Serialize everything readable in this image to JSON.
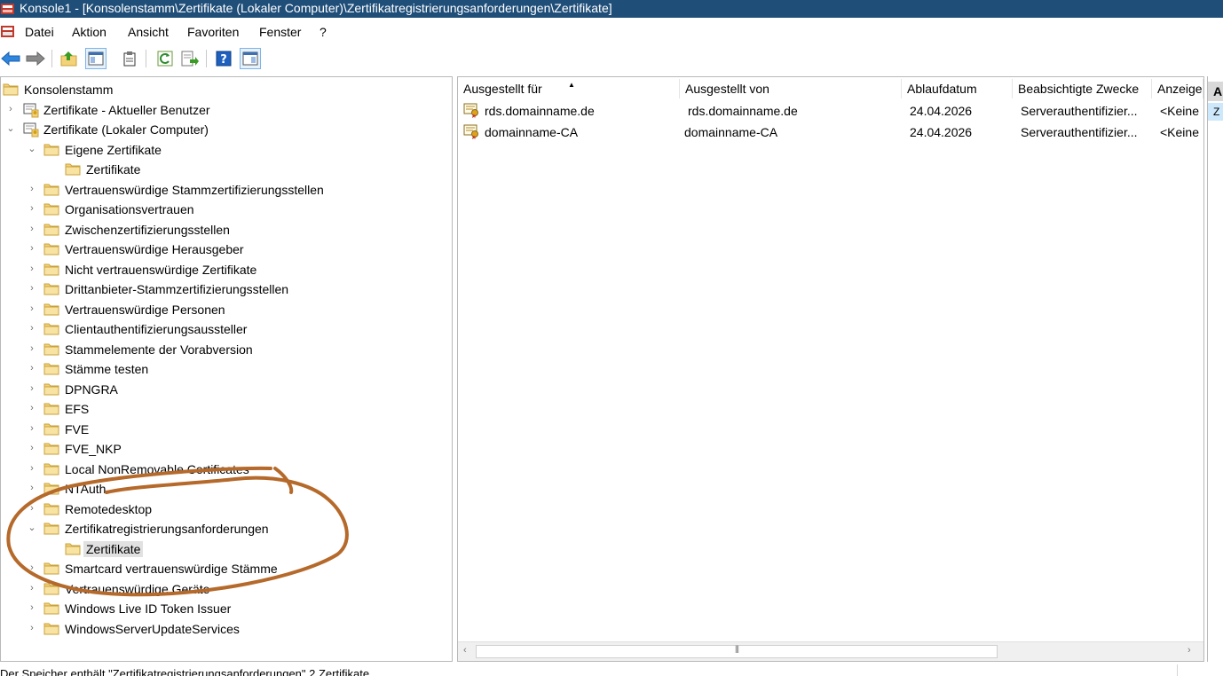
{
  "window": {
    "title": "Konsole1 - [Konsolenstamm\\Zertifikate (Lokaler Computer)\\Zertifikatregistrierungsanforderungen\\Zertifikate]"
  },
  "colors": {
    "titlebar": "#1f4e79",
    "annotation": "#b5692a",
    "folder": "#f3d27a",
    "selection": "#e1e1e1"
  },
  "menu": [
    "Datei",
    "Aktion",
    "Ansicht",
    "Favoriten",
    "Fenster",
    "?"
  ],
  "toolbar": {
    "buttons": [
      {
        "name": "back-arrow-icon"
      },
      {
        "name": "forward-arrow-icon"
      },
      {
        "name": "up-folder-icon"
      },
      {
        "name": "show-hide-tree-icon"
      },
      {
        "name": "clipboard-icon"
      },
      {
        "name": "refresh-icon"
      },
      {
        "name": "export-list-icon"
      },
      {
        "name": "help-icon"
      },
      {
        "name": "show-hide-action-pane-icon"
      }
    ]
  },
  "tree": {
    "items": [
      {
        "label": "Konsolenstamm",
        "indent": 0,
        "expander": "none",
        "icon": "folder-icon"
      },
      {
        "label": "Zertifikate - Aktueller Benutzer",
        "indent": 1,
        "expander": "collapsed",
        "icon": "certificate-snapin-icon"
      },
      {
        "label": "Zertifikate (Lokaler Computer)",
        "indent": 1,
        "expander": "expanded",
        "icon": "certificate-snapin-icon"
      },
      {
        "label": "Eigene Zertifikate",
        "indent": 2,
        "expander": "expanded",
        "icon": "folder-icon"
      },
      {
        "label": "Zertifikate",
        "indent": 3,
        "expander": "none",
        "icon": "folder-icon"
      },
      {
        "label": "Vertrauenswürdige Stammzertifizierungsstellen",
        "indent": 2,
        "expander": "collapsed",
        "icon": "folder-icon"
      },
      {
        "label": "Organisationsvertrauen",
        "indent": 2,
        "expander": "collapsed",
        "icon": "folder-icon"
      },
      {
        "label": "Zwischenzertifizierungsstellen",
        "indent": 2,
        "expander": "collapsed",
        "icon": "folder-icon"
      },
      {
        "label": "Vertrauenswürdige Herausgeber",
        "indent": 2,
        "expander": "collapsed",
        "icon": "folder-icon"
      },
      {
        "label": "Nicht vertrauenswürdige Zertifikate",
        "indent": 2,
        "expander": "collapsed",
        "icon": "folder-icon"
      },
      {
        "label": "Drittanbieter-Stammzertifizierungsstellen",
        "indent": 2,
        "expander": "collapsed",
        "icon": "folder-icon"
      },
      {
        "label": "Vertrauenswürdige Personen",
        "indent": 2,
        "expander": "collapsed",
        "icon": "folder-icon"
      },
      {
        "label": "Clientauthentifizierungsaussteller",
        "indent": 2,
        "expander": "collapsed",
        "icon": "folder-icon"
      },
      {
        "label": "Stammelemente der Vorabversion",
        "indent": 2,
        "expander": "collapsed",
        "icon": "folder-icon"
      },
      {
        "label": "Stämme testen",
        "indent": 2,
        "expander": "collapsed",
        "icon": "folder-icon"
      },
      {
        "label": "DPNGRA",
        "indent": 2,
        "expander": "collapsed",
        "icon": "folder-icon"
      },
      {
        "label": "EFS",
        "indent": 2,
        "expander": "collapsed",
        "icon": "folder-icon"
      },
      {
        "label": "FVE",
        "indent": 2,
        "expander": "collapsed",
        "icon": "folder-icon"
      },
      {
        "label": "FVE_NKP",
        "indent": 2,
        "expander": "collapsed",
        "icon": "folder-icon"
      },
      {
        "label": "Local NonRemovable Certificates",
        "indent": 2,
        "expander": "collapsed",
        "icon": "folder-icon"
      },
      {
        "label": "NTAuth",
        "indent": 2,
        "expander": "collapsed",
        "icon": "folder-icon"
      },
      {
        "label": "Remotedesktop",
        "indent": 2,
        "expander": "collapsed",
        "icon": "folder-icon"
      },
      {
        "label": "Zertifikatregistrierungsanforderungen",
        "indent": 2,
        "expander": "expanded",
        "icon": "folder-icon"
      },
      {
        "label": "Zertifikate",
        "indent": 3,
        "expander": "none",
        "icon": "folder-icon",
        "selected": true
      },
      {
        "label": "Smartcard vertrauenswürdige Stämme",
        "indent": 2,
        "expander": "collapsed",
        "icon": "folder-icon"
      },
      {
        "label": "Vertrauenswürdige Geräte",
        "indent": 2,
        "expander": "collapsed",
        "icon": "folder-icon"
      },
      {
        "label": "Windows Live ID Token Issuer",
        "indent": 2,
        "expander": "collapsed",
        "icon": "folder-icon"
      },
      {
        "label": "WindowsServerUpdateServices",
        "indent": 2,
        "expander": "collapsed",
        "icon": "folder-icon"
      }
    ]
  },
  "list": {
    "columns": [
      "Ausgestellt für",
      "Ausgestellt von",
      "Ablaufdatum",
      "Beabsichtigte Zwecke",
      "Anzeige"
    ],
    "sorted_column": 0,
    "rows": [
      {
        "issued_to": "rds.domainname.de",
        "issued_by": "rds.domainname.de",
        "expires": "24.04.2026",
        "purposes": "Serverauthentifizier...",
        "display": "<Keine"
      },
      {
        "issued_to": "domainname-CA",
        "issued_by": "domainname-CA",
        "expires": "24.04.2026",
        "purposes": "Serverauthentifizier...",
        "display": "<Keine"
      }
    ]
  },
  "action_pane": {
    "header": "A",
    "item": "Z"
  },
  "statusbar": {
    "text": "Der Speicher enthält \"Zertifikatregistrierungsanforderungen\" 2 Zertifikate."
  }
}
